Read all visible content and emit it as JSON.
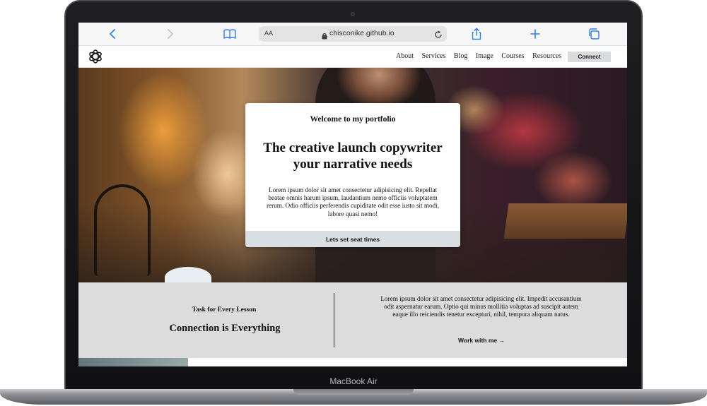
{
  "device": {
    "label": "MacBook Air"
  },
  "browser": {
    "text_size_label": "AA",
    "url": "chisconike.github.io",
    "icons": [
      "back-icon",
      "forward-icon",
      "bookmarks-icon",
      "lock-icon",
      "reload-icon",
      "share-icon",
      "new-tab-icon",
      "tabs-icon"
    ],
    "accent_color": "#2f7ff0"
  },
  "nav": {
    "logo_icon": "openai-logo-icon",
    "links": [
      "About",
      "Services",
      "Blog",
      "Image",
      "Courses",
      "Resources"
    ],
    "connect_label": "Connect"
  },
  "hero": {
    "subtitle": "Welcome to my portfolio",
    "title_line1": "The creative launch copywriter",
    "title_line2": "your narrative needs",
    "body": "Lorem ipsum dolor sit amet consectetur adipisicing elit. Repellat beatae omnis harum ipsum, laudantium nemo officiis voluptatem rerum. Odio officiis perferendis cupiditate odit esse iusto sit modi, labore quasi nemo!",
    "cta_label": "Lets set seat times"
  },
  "feature": {
    "kicker": "Task for Every Lesson",
    "heading": "Connection is Everything",
    "body": "Lorem ipsum dolor sit amet consectetur adipisicing elit. Impedit accusantium odit aspernatur earum. Optio qui minus mollitia voluptas ad suscipit autem eaque illo reiciendis tenetur excepturi, nihil, tempora aliquam natus.",
    "link_label": "Work with me →"
  }
}
